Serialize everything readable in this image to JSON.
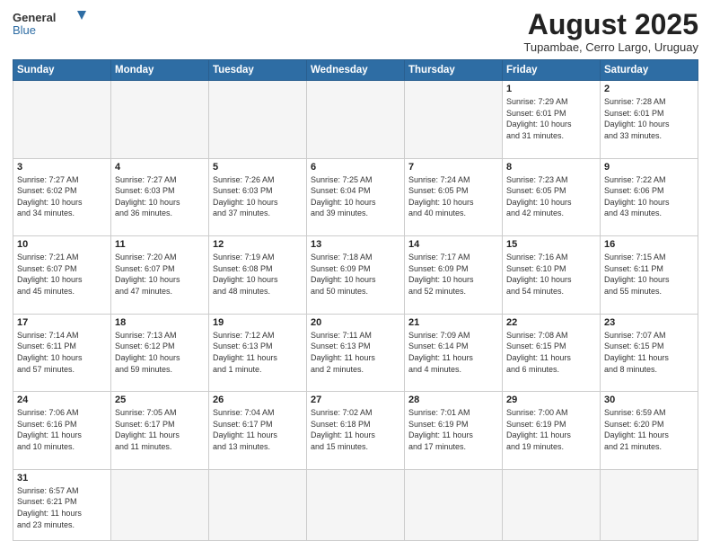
{
  "header": {
    "logo_general": "General",
    "logo_blue": "Blue",
    "month_year": "August 2025",
    "location": "Tupambae, Cerro Largo, Uruguay"
  },
  "weekdays": [
    "Sunday",
    "Monday",
    "Tuesday",
    "Wednesday",
    "Thursday",
    "Friday",
    "Saturday"
  ],
  "weeks": [
    [
      {
        "day": "",
        "info": ""
      },
      {
        "day": "",
        "info": ""
      },
      {
        "day": "",
        "info": ""
      },
      {
        "day": "",
        "info": ""
      },
      {
        "day": "",
        "info": ""
      },
      {
        "day": "1",
        "info": "Sunrise: 7:29 AM\nSunset: 6:01 PM\nDaylight: 10 hours\nand 31 minutes."
      },
      {
        "day": "2",
        "info": "Sunrise: 7:28 AM\nSunset: 6:01 PM\nDaylight: 10 hours\nand 33 minutes."
      }
    ],
    [
      {
        "day": "3",
        "info": "Sunrise: 7:27 AM\nSunset: 6:02 PM\nDaylight: 10 hours\nand 34 minutes."
      },
      {
        "day": "4",
        "info": "Sunrise: 7:27 AM\nSunset: 6:03 PM\nDaylight: 10 hours\nand 36 minutes."
      },
      {
        "day": "5",
        "info": "Sunrise: 7:26 AM\nSunset: 6:03 PM\nDaylight: 10 hours\nand 37 minutes."
      },
      {
        "day": "6",
        "info": "Sunrise: 7:25 AM\nSunset: 6:04 PM\nDaylight: 10 hours\nand 39 minutes."
      },
      {
        "day": "7",
        "info": "Sunrise: 7:24 AM\nSunset: 6:05 PM\nDaylight: 10 hours\nand 40 minutes."
      },
      {
        "day": "8",
        "info": "Sunrise: 7:23 AM\nSunset: 6:05 PM\nDaylight: 10 hours\nand 42 minutes."
      },
      {
        "day": "9",
        "info": "Sunrise: 7:22 AM\nSunset: 6:06 PM\nDaylight: 10 hours\nand 43 minutes."
      }
    ],
    [
      {
        "day": "10",
        "info": "Sunrise: 7:21 AM\nSunset: 6:07 PM\nDaylight: 10 hours\nand 45 minutes."
      },
      {
        "day": "11",
        "info": "Sunrise: 7:20 AM\nSunset: 6:07 PM\nDaylight: 10 hours\nand 47 minutes."
      },
      {
        "day": "12",
        "info": "Sunrise: 7:19 AM\nSunset: 6:08 PM\nDaylight: 10 hours\nand 48 minutes."
      },
      {
        "day": "13",
        "info": "Sunrise: 7:18 AM\nSunset: 6:09 PM\nDaylight: 10 hours\nand 50 minutes."
      },
      {
        "day": "14",
        "info": "Sunrise: 7:17 AM\nSunset: 6:09 PM\nDaylight: 10 hours\nand 52 minutes."
      },
      {
        "day": "15",
        "info": "Sunrise: 7:16 AM\nSunset: 6:10 PM\nDaylight: 10 hours\nand 54 minutes."
      },
      {
        "day": "16",
        "info": "Sunrise: 7:15 AM\nSunset: 6:11 PM\nDaylight: 10 hours\nand 55 minutes."
      }
    ],
    [
      {
        "day": "17",
        "info": "Sunrise: 7:14 AM\nSunset: 6:11 PM\nDaylight: 10 hours\nand 57 minutes."
      },
      {
        "day": "18",
        "info": "Sunrise: 7:13 AM\nSunset: 6:12 PM\nDaylight: 10 hours\nand 59 minutes."
      },
      {
        "day": "19",
        "info": "Sunrise: 7:12 AM\nSunset: 6:13 PM\nDaylight: 11 hours\nand 1 minute."
      },
      {
        "day": "20",
        "info": "Sunrise: 7:11 AM\nSunset: 6:13 PM\nDaylight: 11 hours\nand 2 minutes."
      },
      {
        "day": "21",
        "info": "Sunrise: 7:09 AM\nSunset: 6:14 PM\nDaylight: 11 hours\nand 4 minutes."
      },
      {
        "day": "22",
        "info": "Sunrise: 7:08 AM\nSunset: 6:15 PM\nDaylight: 11 hours\nand 6 minutes."
      },
      {
        "day": "23",
        "info": "Sunrise: 7:07 AM\nSunset: 6:15 PM\nDaylight: 11 hours\nand 8 minutes."
      }
    ],
    [
      {
        "day": "24",
        "info": "Sunrise: 7:06 AM\nSunset: 6:16 PM\nDaylight: 11 hours\nand 10 minutes."
      },
      {
        "day": "25",
        "info": "Sunrise: 7:05 AM\nSunset: 6:17 PM\nDaylight: 11 hours\nand 11 minutes."
      },
      {
        "day": "26",
        "info": "Sunrise: 7:04 AM\nSunset: 6:17 PM\nDaylight: 11 hours\nand 13 minutes."
      },
      {
        "day": "27",
        "info": "Sunrise: 7:02 AM\nSunset: 6:18 PM\nDaylight: 11 hours\nand 15 minutes."
      },
      {
        "day": "28",
        "info": "Sunrise: 7:01 AM\nSunset: 6:19 PM\nDaylight: 11 hours\nand 17 minutes."
      },
      {
        "day": "29",
        "info": "Sunrise: 7:00 AM\nSunset: 6:19 PM\nDaylight: 11 hours\nand 19 minutes."
      },
      {
        "day": "30",
        "info": "Sunrise: 6:59 AM\nSunset: 6:20 PM\nDaylight: 11 hours\nand 21 minutes."
      }
    ],
    [
      {
        "day": "31",
        "info": "Sunrise: 6:57 AM\nSunset: 6:21 PM\nDaylight: 11 hours\nand 23 minutes."
      },
      {
        "day": "",
        "info": ""
      },
      {
        "day": "",
        "info": ""
      },
      {
        "day": "",
        "info": ""
      },
      {
        "day": "",
        "info": ""
      },
      {
        "day": "",
        "info": ""
      },
      {
        "day": "",
        "info": ""
      }
    ]
  ]
}
